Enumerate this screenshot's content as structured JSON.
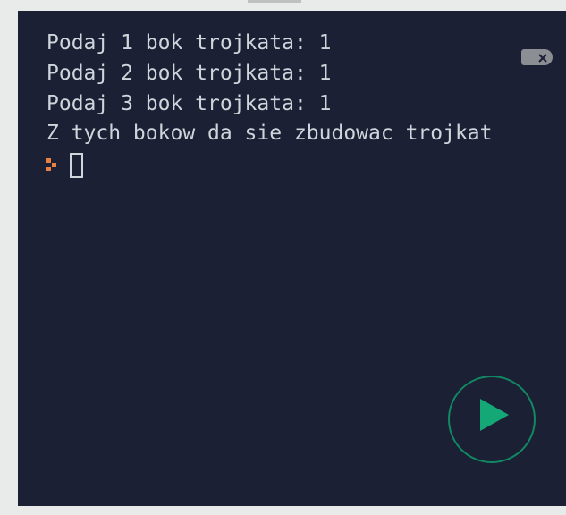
{
  "terminal": {
    "lines": [
      "Podaj 1 bok trojkata: 1",
      "Podaj 2 bok trojkata: 1",
      "Podaj 3 bok trojkata: 1",
      "Z tych bokow da sie zbudowac trojkat"
    ]
  },
  "icons": {
    "close": "close",
    "prompt": "prompt",
    "play": "play"
  }
}
